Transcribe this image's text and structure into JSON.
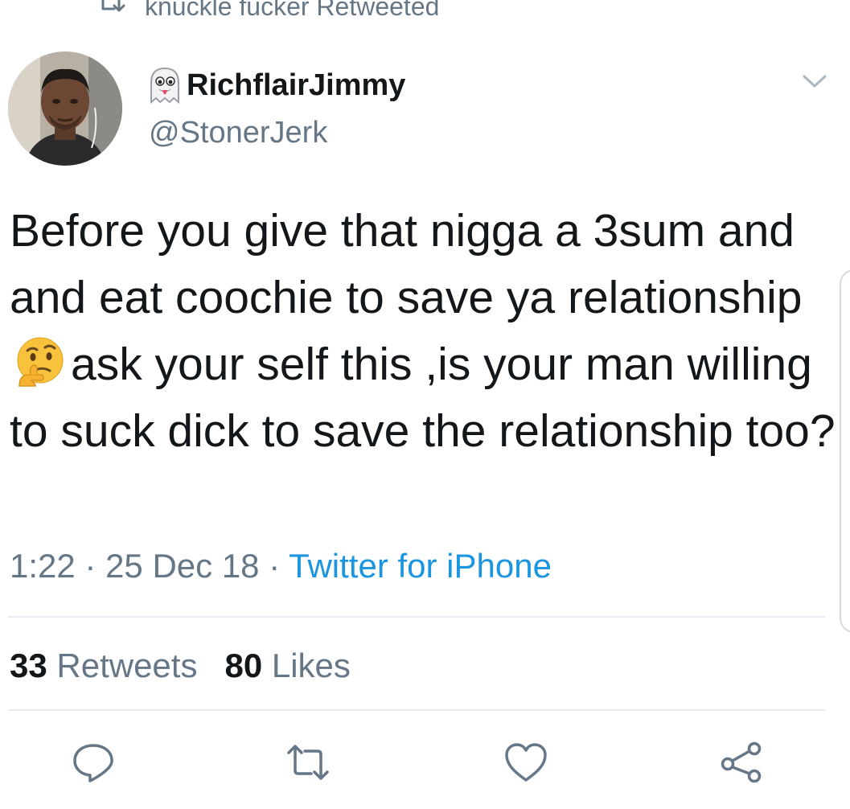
{
  "retweet_context": {
    "label": "knuckle fucker Retweeted",
    "icon": "retweet-icon"
  },
  "author": {
    "avatar_icon": "profile-photo",
    "badge_icon": "ghost-emoji",
    "display_name": "RichflairJimmy",
    "handle": "@StonerJerk"
  },
  "menu": {
    "icon": "chevron-down-icon"
  },
  "tweet": {
    "text_before_emoji": "Before you give that nigga a 3sum and and eat coochie to save ya relationship ",
    "emoji": "thinking-face-emoji",
    "text_after_emoji": "ask your self this ,is your man willing to suck dick to save the relationship too?"
  },
  "meta": {
    "time": "1:22",
    "separator": " · ",
    "date": "25 Dec 18",
    "source": "Twitter for iPhone"
  },
  "stats": {
    "retweets_count": "33",
    "retweets_label": " Retweets",
    "likes_count": "80",
    "likes_label": " Likes"
  },
  "actions": {
    "reply_icon": "reply-icon",
    "retweet_icon": "retweet-icon",
    "like_icon": "heart-icon",
    "share_icon": "share-icon"
  },
  "colors": {
    "text_primary": "#14171a",
    "text_secondary": "#657786",
    "link": "#1b95e0",
    "divider": "#e6ecf0"
  }
}
